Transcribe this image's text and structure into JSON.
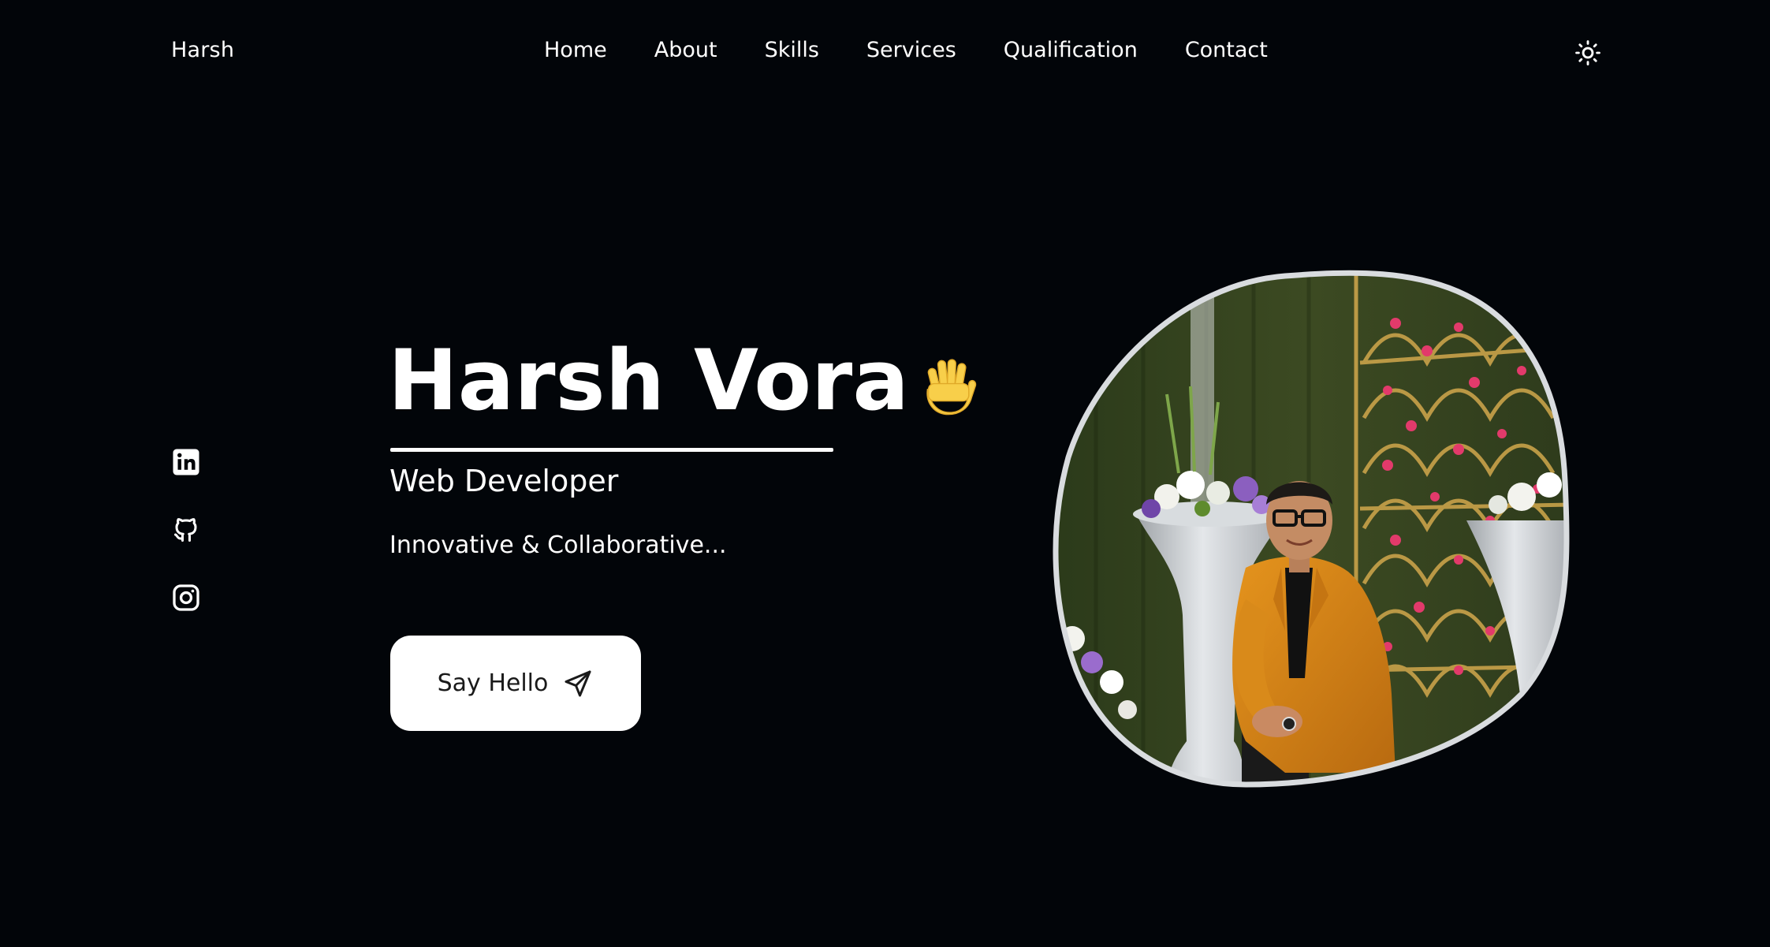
{
  "header": {
    "logo": "Harsh",
    "nav": [
      {
        "label": "Home"
      },
      {
        "label": "About"
      },
      {
        "label": "Skills"
      },
      {
        "label": "Services"
      },
      {
        "label": "Qualification"
      },
      {
        "label": "Contact"
      }
    ],
    "theme_icon": "sun-icon"
  },
  "socials": [
    {
      "icon": "linkedin-icon"
    },
    {
      "icon": "github-icon"
    },
    {
      "icon": "instagram-icon"
    }
  ],
  "hero": {
    "name": "Harsh Vora",
    "wave_icon": "waving-hand-icon",
    "role": "Web Developer",
    "tagline": "Innovative & Collaborative...",
    "cta_label": "Say Hello",
    "cta_icon": "send-icon"
  },
  "profile": {
    "image": "profile-photo"
  },
  "colors": {
    "background": "#020509",
    "text": "#ffffff",
    "button_bg": "#ffffff",
    "button_text": "#1a1a1a",
    "blob_border": "#d9dcdf"
  }
}
